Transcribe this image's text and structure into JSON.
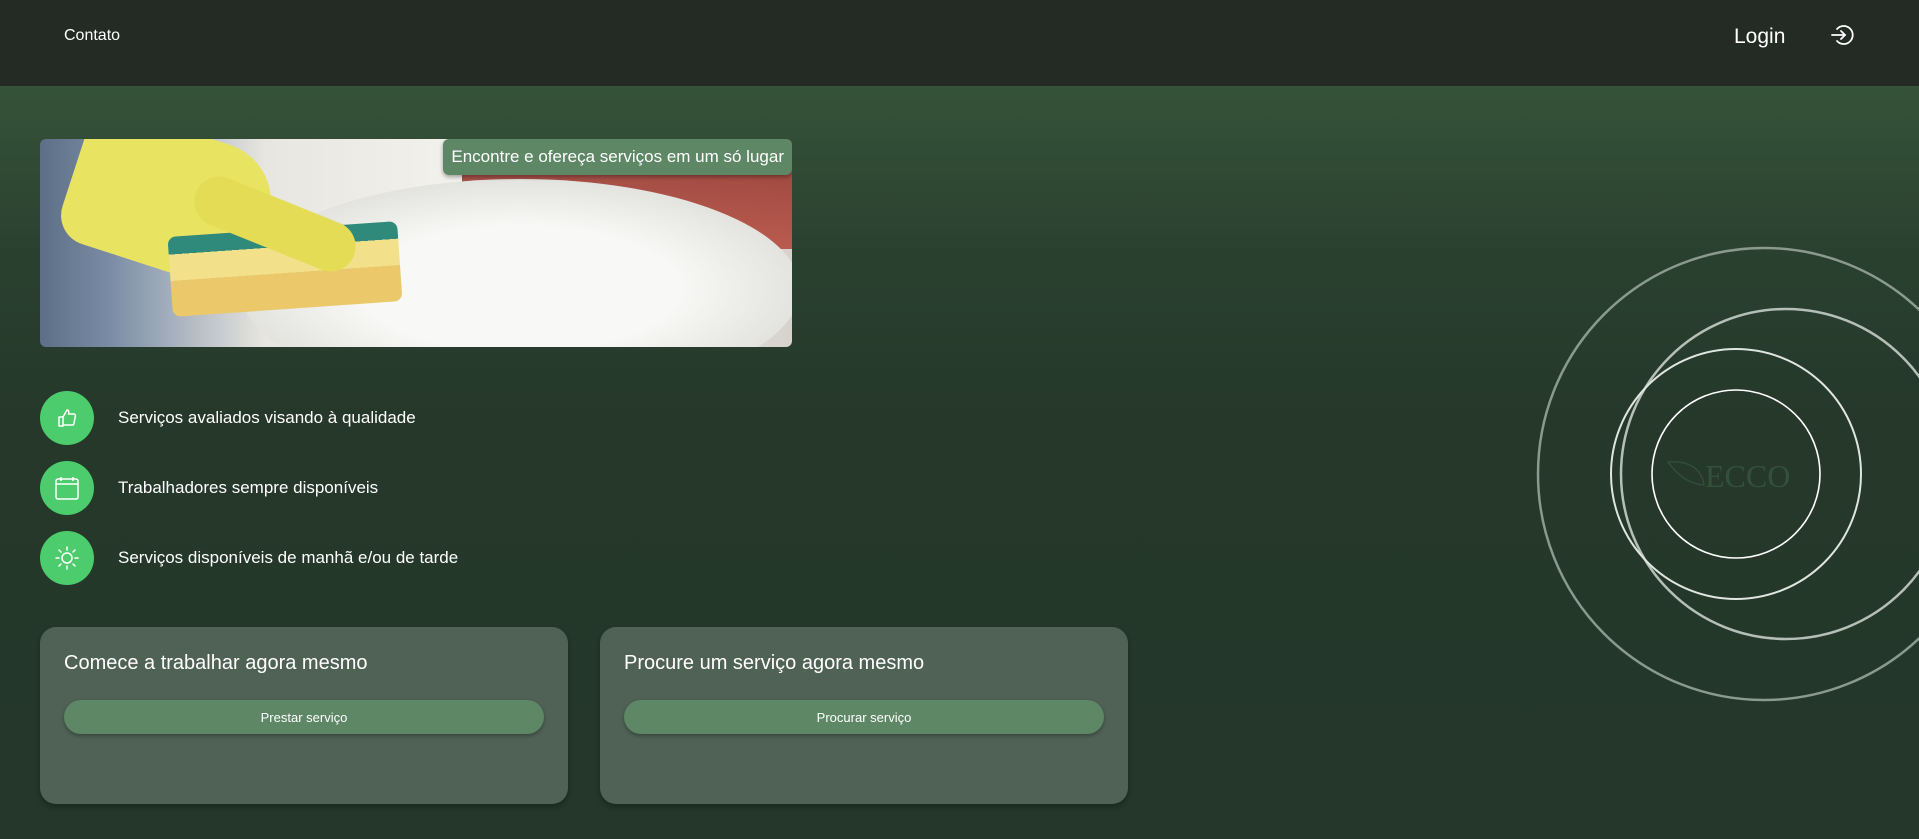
{
  "header": {
    "contact_label": "Contato",
    "login_label": "Login",
    "login_icon": "login-icon"
  },
  "banner": {
    "caption": "Encontre e ofereça serviços em um só lugar"
  },
  "features": [
    {
      "icon": "thumbs-up-icon",
      "label": "Serviços avaliados visando à qualidade"
    },
    {
      "icon": "calendar-icon",
      "label": "Trabalhadores sempre disponíveis"
    },
    {
      "icon": "sun-icon",
      "label": "Serviços disponíveis de manhã e/ou de tarde"
    }
  ],
  "cards": [
    {
      "title": "Comece a trabalhar agora mesmo",
      "button": "Prestar serviço"
    },
    {
      "title": "Procure um serviço agora mesmo",
      "button": "Procurar serviço"
    }
  ],
  "logo": {
    "text": "ECCO"
  },
  "colors": {
    "header": "#232b24",
    "accent": "#4ccc6c",
    "button": "#5e8766",
    "card": "#506256"
  }
}
